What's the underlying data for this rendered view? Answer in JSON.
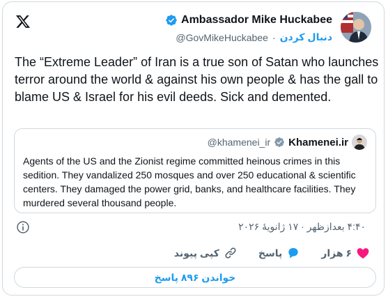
{
  "tweet": {
    "author": {
      "name": "Ambassador Mike Huckabee",
      "handle": "@GovMikeHuckabee",
      "follow_label": "دنبال کردن",
      "separator": "·"
    },
    "text": "The “Extreme Leader” of Iran is a true son of Satan who launches terror around the world & against his own people & has the gall to blame US & Israel for his evil deeds.  Sick and demented.",
    "quote": {
      "name": "Khamenei.ir",
      "handle": "@khamenei_ir",
      "text": "Agents of the US and the Zionist regime committed heinous crimes in this sedition. They vandalized 250 mosques and over 250 educational & scientific centers. They damaged the power grid, banks, and healthcare facilities. They murdered several thousand people."
    },
    "timestamp": "۴:۴۰ بعدازظهر · ۱۷ ژانویهٔ ۲۰۲۶",
    "actions": {
      "likes": "۶ هزار",
      "reply": "پاسخ",
      "copy_link": "کپی پیوند"
    },
    "read_replies": "خواندن ۸۹۶ پاسخ"
  },
  "colors": {
    "accent": "#1d9bf0",
    "like": "#f91880",
    "text": "#0f1419",
    "muted": "#536471",
    "border": "#cfd9de"
  },
  "icons": [
    "x-logo-icon",
    "verified-icon",
    "verified-grey-icon",
    "info-icon",
    "heart-icon",
    "reply-icon",
    "link-icon"
  ]
}
